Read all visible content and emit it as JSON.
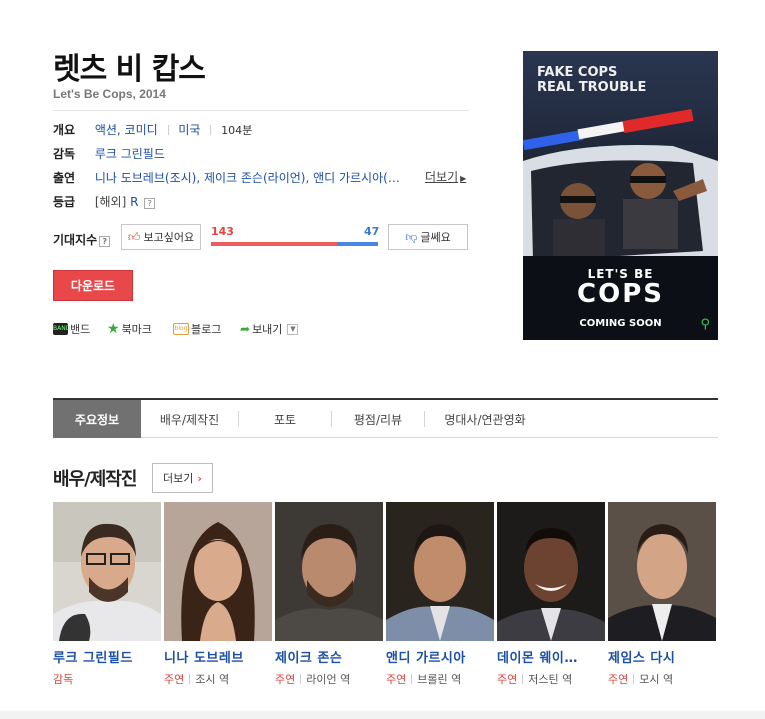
{
  "movie": {
    "title": "렛츠 비 캅스",
    "subtitle": "Let's Be Cops, 2014"
  },
  "info": {
    "overview_label": "개요",
    "genre": "액션, 코미디",
    "country": "미국",
    "runtime": "104분",
    "director_label": "감독",
    "director": "루크 그린필드",
    "cast_label": "출연",
    "cast_text": "니나 도브레브(조시), 제이크 존슨(라이언), 앤디 가르시아(…",
    "cast_more": "더보기",
    "rating_label": "등급",
    "rating_region": "[해외]",
    "rating": "R",
    "help_glyph": "?"
  },
  "expectation": {
    "label": "기대지수",
    "want_label": "보고싶어요",
    "meh_label": "글쎄요",
    "want_count": "143",
    "meh_count": "47",
    "want_ratio": 0.753
  },
  "download_label": "다운로드",
  "share": {
    "band": "밴드",
    "bookmark": "북마크",
    "blog": "블로그",
    "send": "보내기"
  },
  "poster": {
    "tagline1": "FAKE COPS",
    "tagline2": "REAL TROUBLE",
    "title1": "LET'S BE",
    "title2": "COPS",
    "coming": "COMING SOON"
  },
  "tabs": [
    "주요정보",
    "배우/제작진",
    "포토",
    "평점/리뷰",
    "명대사/연관영화"
  ],
  "cast_section": {
    "title": "배우/제작진",
    "more_label": "더보기",
    "people": [
      {
        "name": "루크 그린필드",
        "role": "감독",
        "character": ""
      },
      {
        "name": "니나 도브레브",
        "role": "주연",
        "character": "조시 역"
      },
      {
        "name": "제이크 존슨",
        "role": "주연",
        "character": "라이언 역"
      },
      {
        "name": "앤디 가르시아",
        "role": "주연",
        "character": "브롤린 역"
      },
      {
        "name": "데이몬 웨이…",
        "role": "주연",
        "character": "저스틴 역"
      },
      {
        "name": "제임스 다시",
        "role": "주연",
        "character": "모시 역"
      }
    ]
  },
  "colors": {
    "accent_red": "#e9484b",
    "link_blue": "#1c4fa6",
    "meh_blue": "#4a86e0"
  }
}
